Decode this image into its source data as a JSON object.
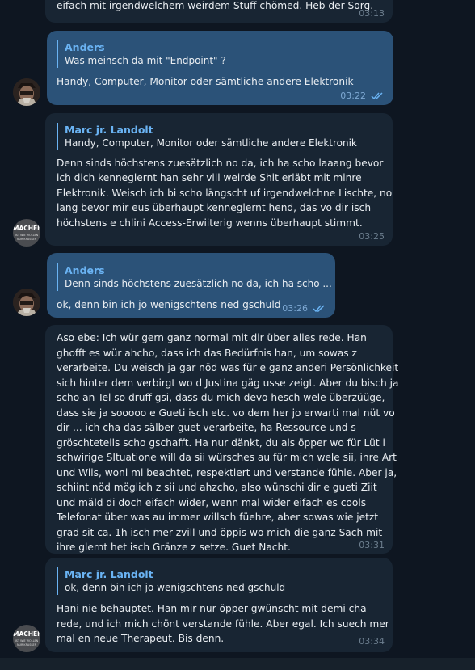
{
  "messages": [
    {
      "id": "m0",
      "text_lines": [
        "eifach mit irgendwelchem weirdem Stuff chömed. Heb der Sorg."
      ],
      "time": "03:13"
    },
    {
      "id": "m1",
      "reply_to": {
        "name": "Anders",
        "text": "Was meinsch da mit \"Endpoint\" ?"
      },
      "text_lines": [
        "Handy, Computer, Monitor oder sämtliche andere Elektronik"
      ],
      "time": "03:22"
    },
    {
      "id": "m2",
      "reply_to": {
        "name": "Marc jr. Landolt",
        "text": "Handy, Computer, Monitor oder sämtliche andere Elektronik"
      },
      "text_lines": [
        "Denn sinds höchstens zuesätzlich no da, ich ha scho laaang bevor",
        "ich dich kenneglernt han sehr vill weirde Shit erläbt mit minre",
        "Elektronik. Weisch ich bi scho längscht uf irgendwelchne Lischte, no",
        "lang bevor mir eus überhaupt kenneglernt hend, das vo dir isch",
        "höchstens e chlini Access-Erwiiterig wenns überhaupt stimmt."
      ],
      "time": "03:25"
    },
    {
      "id": "m3",
      "reply_to": {
        "name": "Anders",
        "text": "Denn sinds höchstens zuesätzlich no da, ich ha scho ..."
      },
      "text_lines": [
        "ok, denn bin ich jo wenigschtens ned gschuld"
      ],
      "time": "03:26"
    },
    {
      "id": "m4",
      "text_lines": [
        "Aso ebe: Ich wür gern ganz normal mit dir über alles rede. Han",
        "ghofft es wür ahcho, dass ich das Bedürfnis han, um sowas z",
        "verarbeite. Du weisch ja gar nöd was für e ganz anderi Persönlichkeit",
        "sich hinter dem verbirgt wo d Justina gäg usse zeigt. Aber du bisch ja",
        "scho an Tel so druff gsi, dass du mich devo hesch wele überzüüge,",
        "dass sie ja sooooo e Gueti isch etc. vo dem her jo erwarti mal nüt vo",
        "dir ... ich cha das sälber guet verarbeite, ha Ressource und s",
        "gröschteteils scho gschafft. Ha nur dänkt, du als öpper wo für Lüt i",
        "schwirige SItuatione will da sii würsches au für mich wele sii, inre Art",
        "und Wiis, woni mi beachtet, respektiert und verstande fühle. Aber ja,",
        "schiint nöd möglich z sii und ahzcho, also wünschi dir e gueti Ziit",
        "und mäld di doch eifach wider, wenn mal wider eifach es cools",
        "Telefonat über was au immer willsch füehre, aber sowas wie jetzt",
        "grad sit ca. 1h isch mer zvill und öppis wo mich die ganz Sach mit",
        "ihre glernt het isch Gränze z setze. Guet Nacht."
      ],
      "time": "03:31"
    },
    {
      "id": "m5",
      "reply_to": {
        "name": "Marc jr. Landolt",
        "text": "ok, denn bin ich jo wenigschtens ned gschuld"
      },
      "text_lines": [
        "Hani nie behauptet. Han mir nur öpper gwünscht mit demi cha",
        "rede, und ich mich chönt verstande fühle. Aber egal. Ich suech mer",
        "mal en neue Therapeut. Bis denn."
      ],
      "time": "03:34"
    }
  ],
  "avatar_machen": {
    "line1": "MACHEN",
    "line2": "IST WIE WOLLEN",
    "line3": "NUR KRASSER"
  },
  "colors": {
    "background": "#0e1621",
    "incoming_bubble": "#182533",
    "outgoing_bubble": "#2b5278",
    "reply_accent": "#6ab3f3",
    "read_checks": "#6ab3f3"
  }
}
